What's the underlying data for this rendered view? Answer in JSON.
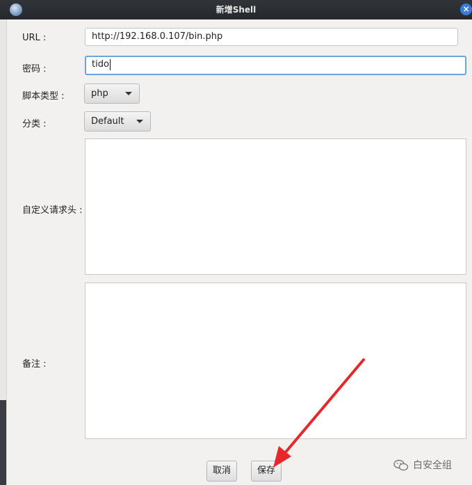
{
  "window": {
    "title": "新增Shell",
    "close_glyph": "×",
    "app_icon": "globe-icon"
  },
  "form": {
    "url": {
      "label": "URL :",
      "value": "http://192.168.0.107/bin.php"
    },
    "password": {
      "label": "密码 :",
      "value": "tido"
    },
    "script_type": {
      "label": "脚本类型 :",
      "selected": "php"
    },
    "category": {
      "label": "分类 :",
      "selected": "Default"
    },
    "custom_headers": {
      "label": "自定义请求头 :",
      "value": ""
    },
    "notes": {
      "label": "备注 :",
      "value": ""
    }
  },
  "buttons": {
    "cancel": "取消",
    "save": "保存"
  },
  "annotation": {
    "arrow_color": "#e8272a"
  },
  "watermark": {
    "icon": "wechat-icon",
    "text": "白安全组"
  }
}
